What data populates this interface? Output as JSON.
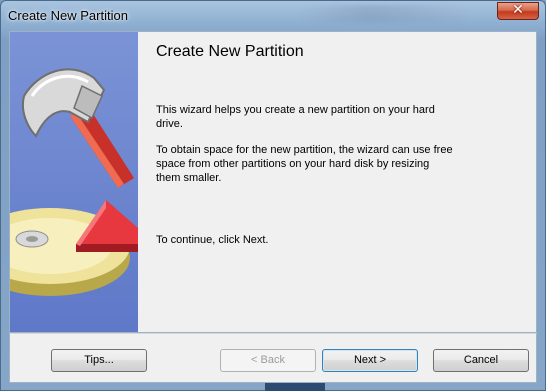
{
  "window": {
    "title": "Create New Partition",
    "close_label": "✕"
  },
  "wizard": {
    "heading": "Create New Partition",
    "paragraph1": "This wizard helps you create a new partition on your hard drive.",
    "paragraph2": "To obtain space for the new partition, the wizard can use free space from other partitions on your hard disk by resizing them smaller.",
    "paragraph3": "To continue, click Next."
  },
  "buttons": {
    "tips": "Tips...",
    "back": "< Back",
    "next": "Next >",
    "cancel": "Cancel"
  },
  "banner": {
    "icons": [
      "hammer-icon",
      "disk-icon",
      "pie-wedge-icon"
    ],
    "colors": {
      "background": "#6a83cf",
      "wedge": "#d8303a",
      "disk": "#e8d888"
    }
  }
}
